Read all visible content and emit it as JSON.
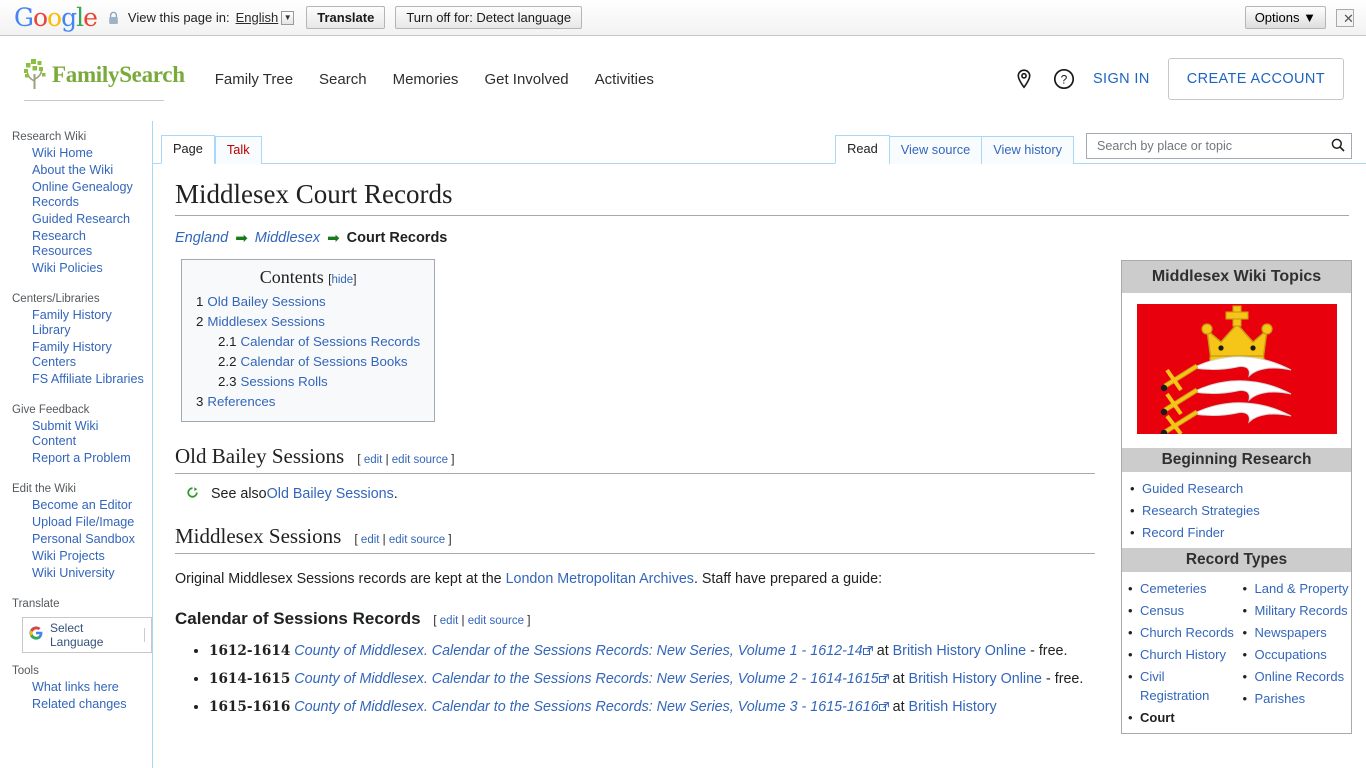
{
  "translate_bar": {
    "logo": [
      "G",
      "o",
      "o",
      "g",
      "l",
      "e"
    ],
    "lock_icon": "lock-icon",
    "label": "View this page in:",
    "language": "English",
    "caret": "▼",
    "translate_button": "Translate",
    "turn_off_button": "Turn off for: Detect language",
    "options_button": "Options",
    "options_caret": "▼",
    "close_button": "✕"
  },
  "site_header": {
    "brand": "FamilySearch",
    "nav": [
      {
        "label": "Family Tree"
      },
      {
        "label": "Search"
      },
      {
        "label": "Memories"
      },
      {
        "label": "Get Involved"
      },
      {
        "label": "Activities"
      }
    ],
    "location_icon": "map-pin-icon",
    "help_icon": "question-circle-icon",
    "sign_in": "SIGN IN",
    "create_account": "CREATE ACCOUNT",
    "link_color": "#1d65c1",
    "brand_color": "#7aa93c"
  },
  "sidebar": {
    "groups": [
      {
        "heading": "Research Wiki",
        "items": [
          {
            "label": "Wiki Home"
          },
          {
            "label": "About the Wiki"
          },
          {
            "label": "Online Genealogy Records"
          },
          {
            "label": "Guided Research"
          },
          {
            "label": "Research Resources"
          },
          {
            "label": "Wiki Policies"
          }
        ]
      },
      {
        "heading": "Centers/Libraries",
        "items": [
          {
            "label": "Family History Library"
          },
          {
            "label": "Family History Centers"
          },
          {
            "label": "FS Affiliate Libraries"
          }
        ]
      },
      {
        "heading": "Give Feedback",
        "items": [
          {
            "label": "Submit Wiki Content"
          },
          {
            "label": "Report a Problem"
          }
        ]
      },
      {
        "heading": "Edit the Wiki",
        "items": [
          {
            "label": "Become an Editor"
          },
          {
            "label": "Upload File/Image"
          },
          {
            "label": "Personal Sandbox"
          },
          {
            "label": "Wiki Projects"
          },
          {
            "label": "Wiki University"
          }
        ]
      }
    ],
    "translate_heading": "Translate",
    "select_language": "Select Language",
    "google_g": "G",
    "tools_heading": "Tools",
    "tools_items": [
      {
        "label": "What links here"
      },
      {
        "label": "Related changes"
      }
    ]
  },
  "tabs": {
    "left": [
      {
        "label": "Page",
        "state": "selected"
      },
      {
        "label": "Talk",
        "state": "newpage"
      }
    ],
    "right": [
      {
        "label": "Read",
        "state": "selected"
      },
      {
        "label": "View source",
        "state": "normal"
      },
      {
        "label": "View history",
        "state": "normal"
      }
    ]
  },
  "search": {
    "placeholder": "Search by place or topic",
    "value": "",
    "icon": "search-icon"
  },
  "article": {
    "title": "Middlesex Court Records",
    "breadcrumb": {
      "items": [
        "England",
        "Middlesex"
      ],
      "arrow": "➡",
      "current": "Court Records"
    },
    "toc": {
      "title": "Contents",
      "hide_open": "[",
      "hide": "hide",
      "hide_close": "]",
      "entries": [
        {
          "num": "1",
          "label": "Old Bailey Sessions",
          "level": 1
        },
        {
          "num": "2",
          "label": "Middlesex Sessions",
          "level": 1
        },
        {
          "num": "2.1",
          "label": "Calendar of Sessions Records",
          "level": 2
        },
        {
          "num": "2.2",
          "label": "Calendar of Sessions Books",
          "level": 2
        },
        {
          "num": "2.3",
          "label": "Sessions Rolls",
          "level": 2
        },
        {
          "num": "3",
          "label": "References",
          "level": 1
        }
      ]
    },
    "edit_links": {
      "open": "[",
      "edit": "edit",
      "sep": "|",
      "edit_source": "edit source",
      "close": "]"
    },
    "sections": {
      "old_bailey": {
        "heading": "Old Bailey Sessions",
        "seealso_prefix": "See also ",
        "seealso_link": "Old Bailey Sessions",
        "seealso_suffix": ".",
        "seealso_icon": "green-arrow-icon"
      },
      "middlesex_sessions": {
        "heading": "Middlesex Sessions",
        "para_before": "Original Middlesex Sessions records are kept at the ",
        "para_link": "London Metropolitan Archives",
        "para_after": ". Staff have prepared a guide:"
      },
      "calendar_records": {
        "heading": "Calendar of Sessions Records",
        "items": [
          {
            "years": "1612-1614",
            "title": "County of Middlesex. Calendar of the Sessions Records: New Series, Volume 1 - 1612-14",
            "at": " at ",
            "source": "British History Online",
            "cost": " - free."
          },
          {
            "years": "1614-1615",
            "title": "County of Middlesex. Calendar to the Sessions Records: New Series, Volume 2 - 1614-1615",
            "at": " at ",
            "source": "British History Online",
            "cost": " - free."
          },
          {
            "years": "1615-1616",
            "title": "County of Middlesex. Calendar to the Sessions Records: New Series, Volume 3 - 1615-1616",
            "at": " at ",
            "source": "British History",
            "cost": ""
          }
        ]
      }
    }
  },
  "infobox": {
    "title": "Middlesex Wiki Topics",
    "flag": {
      "name": "middlesex-flag",
      "background": "#e8000d",
      "charge_color": "#ffffff",
      "crown_color": "#f5c518"
    },
    "sections": [
      {
        "heading": "Beginning Research",
        "layout": "single",
        "items": [
          {
            "label": "Guided Research"
          },
          {
            "label": "Research Strategies"
          },
          {
            "label": "Record Finder"
          }
        ]
      },
      {
        "heading": "Record Types",
        "layout": "two-column",
        "left": [
          {
            "label": "Cemeteries"
          },
          {
            "label": "Census"
          },
          {
            "label": "Church Records"
          },
          {
            "label": "Church History"
          },
          {
            "label": "Civil Registration"
          },
          {
            "label": "Court",
            "current": true
          }
        ],
        "right": [
          {
            "label": "Land & Property"
          },
          {
            "label": "Military Records"
          },
          {
            "label": "Newspapers"
          },
          {
            "label": "Occupations"
          },
          {
            "label": "Online Records"
          },
          {
            "label": "Parishes"
          }
        ]
      }
    ]
  }
}
